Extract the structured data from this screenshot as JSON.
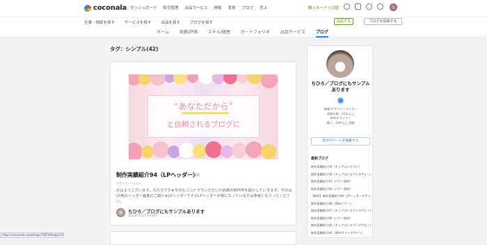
{
  "header": {
    "logo": "coconala",
    "nav": [
      "ダッシュボード",
      "取引管理",
      "出品サービス",
      "再販",
      "意見",
      "ブログ",
      "売上"
    ],
    "buyer_mode": "購入モードへ切替"
  },
  "subheader": {
    "nav": [
      "仕事・相談を探す",
      "サービスを探す",
      "出品を探す",
      "ブログを探す"
    ],
    "publish_button": "出品する",
    "blog_button": "ブログを投稿する"
  },
  "tabs": [
    {
      "label": "ホーム",
      "active": false
    },
    {
      "label": "実績/評価",
      "active": false
    },
    {
      "label": "スキル/経歴",
      "active": false
    },
    {
      "label": "ポートフォリオ",
      "active": false
    },
    {
      "label": "出品サービス",
      "active": false
    },
    {
      "label": "ブログ",
      "active": true
    }
  ],
  "tag_title": "タグ：シンプル(42)",
  "post": {
    "hero_quote": "“あなただから”",
    "hero_sub": "と信頼されるブログに",
    "title": "制作実績紹介94（LPヘッダー）",
    "badge": "最新",
    "category": "デザイン・イラスト",
    "excerpt": "おはようございます。ちひろです★今日もココナラでいただいた依頼の制作例を紹介していきます。今日はLP用のヘッダー画像のご紹介★LPヘッダーでそのLPヘッダーが気になっている方は参考になさってください。",
    "author": "ちひろ／ブログにもサンプルあります",
    "date": "2023/02/21 09:00"
  },
  "sidebar": {
    "name": "ちひろ／ブログにもサンプルあります",
    "meta": [
      "編集/デザイン・ライター",
      "経験年数：20年以上",
      "Webデザイナー",
      "購入：30件以上 実績"
    ],
    "button": "自分のページを編集する",
    "recent_heading": "最新ブログ",
    "recent": [
      "制作実績紹介93（チップコンセプト）",
      "制作実績紹介92（チップコンセプトデザイン）",
      "制作実績紹介91（バナー制作）",
      "制作実績紹介90（バナー制作）",
      "【制作】制作実績紹介89（LPヘッダーデザイン）",
      "制作実績紹介88（Webバナー）",
      "制作実績紹介87（チップコンセプトデザイン）",
      "制作実績紹介86（バナー制作）",
      "制作実績紹介85（チップコンセプトデザイン）",
      "制作実績紹介84（Webサイトデザイン）"
    ]
  },
  "status_url": "https://coconala.com/blogs/758759/tags/1458",
  "colors": {
    "accent": "#2b7fe0",
    "green": "#5a9c2a",
    "pink": "#e98ca6"
  }
}
